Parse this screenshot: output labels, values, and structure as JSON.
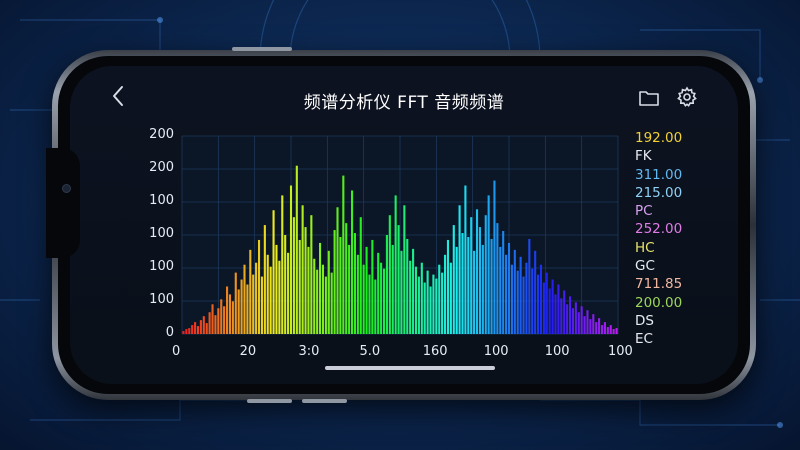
{
  "app": {
    "title": "频谱分析仪 FFT 音频频谱"
  },
  "icons": {
    "back": "chevron-left-icon",
    "folder": "folder-icon",
    "settings": "gear-icon"
  },
  "chart_data": {
    "type": "bar",
    "title": "",
    "xlabel": "",
    "ylabel": "",
    "y_tick_labels": [
      "200",
      "200",
      "100",
      "100",
      "100",
      "100",
      "0"
    ],
    "x_tick_labels": [
      "0",
      "20",
      "3:0",
      "5.0",
      "160",
      "100",
      "100",
      "100"
    ],
    "legend": [
      {
        "label": "192.00",
        "color": "#f2d233"
      },
      {
        "label": "FK",
        "color": "#e8ecf2"
      },
      {
        "label": "311.00",
        "color": "#62b8f0"
      },
      {
        "label": "215.00",
        "color": "#8fd0f5"
      },
      {
        "label": "PC",
        "color": "#d7a0ee"
      },
      {
        "label": "252.00",
        "color": "#e07be6"
      },
      {
        "label": "HC",
        "color": "#e9e36a"
      },
      {
        "label": "GC",
        "color": "#e8ecf2"
      },
      {
        "label": "711.85",
        "color": "#f0b8a0"
      },
      {
        "label": "200.00",
        "color": "#9bd65a"
      },
      {
        "label": "DS",
        "color": "#e8ecf2"
      },
      {
        "label": "EC",
        "color": "#e8ecf2"
      }
    ],
    "grid": true,
    "x_range": [
      0,
      100
    ],
    "y_range": [
      0,
      200
    ],
    "bins": [
      3,
      5,
      6,
      9,
      12,
      8,
      14,
      18,
      11,
      22,
      30,
      19,
      26,
      35,
      28,
      48,
      40,
      33,
      62,
      45,
      55,
      70,
      50,
      85,
      60,
      72,
      95,
      58,
      110,
      80,
      68,
      125,
      90,
      74,
      140,
      100,
      82,
      150,
      118,
      170,
      95,
      130,
      108,
      88,
      120,
      76,
      65,
      92,
      70,
      58,
      84,
      62,
      105,
      128,
      98,
      160,
      112,
      90,
      145,
      102,
      80,
      118,
      70,
      88,
      60,
      95,
      55,
      82,
      72,
      66,
      100,
      120,
      90,
      140,
      110,
      84,
      130,
      96,
      74,
      86,
      68,
      58,
      72,
      52,
      64,
      48,
      60,
      56,
      70,
      62,
      80,
      95,
      72,
      110,
      88,
      130,
      102,
      150,
      98,
      118,
      84,
      126,
      108,
      90,
      120,
      140,
      96,
      155,
      112,
      88,
      104,
      80,
      92,
      70,
      85,
      64,
      78,
      58,
      72,
      96,
      66,
      84,
      60,
      70,
      52,
      62,
      46,
      55,
      40,
      50,
      36,
      44,
      30,
      38,
      26,
      32,
      22,
      28,
      18,
      24,
      15,
      20,
      12,
      16,
      9,
      12,
      7,
      9,
      5,
      6
    ]
  }
}
